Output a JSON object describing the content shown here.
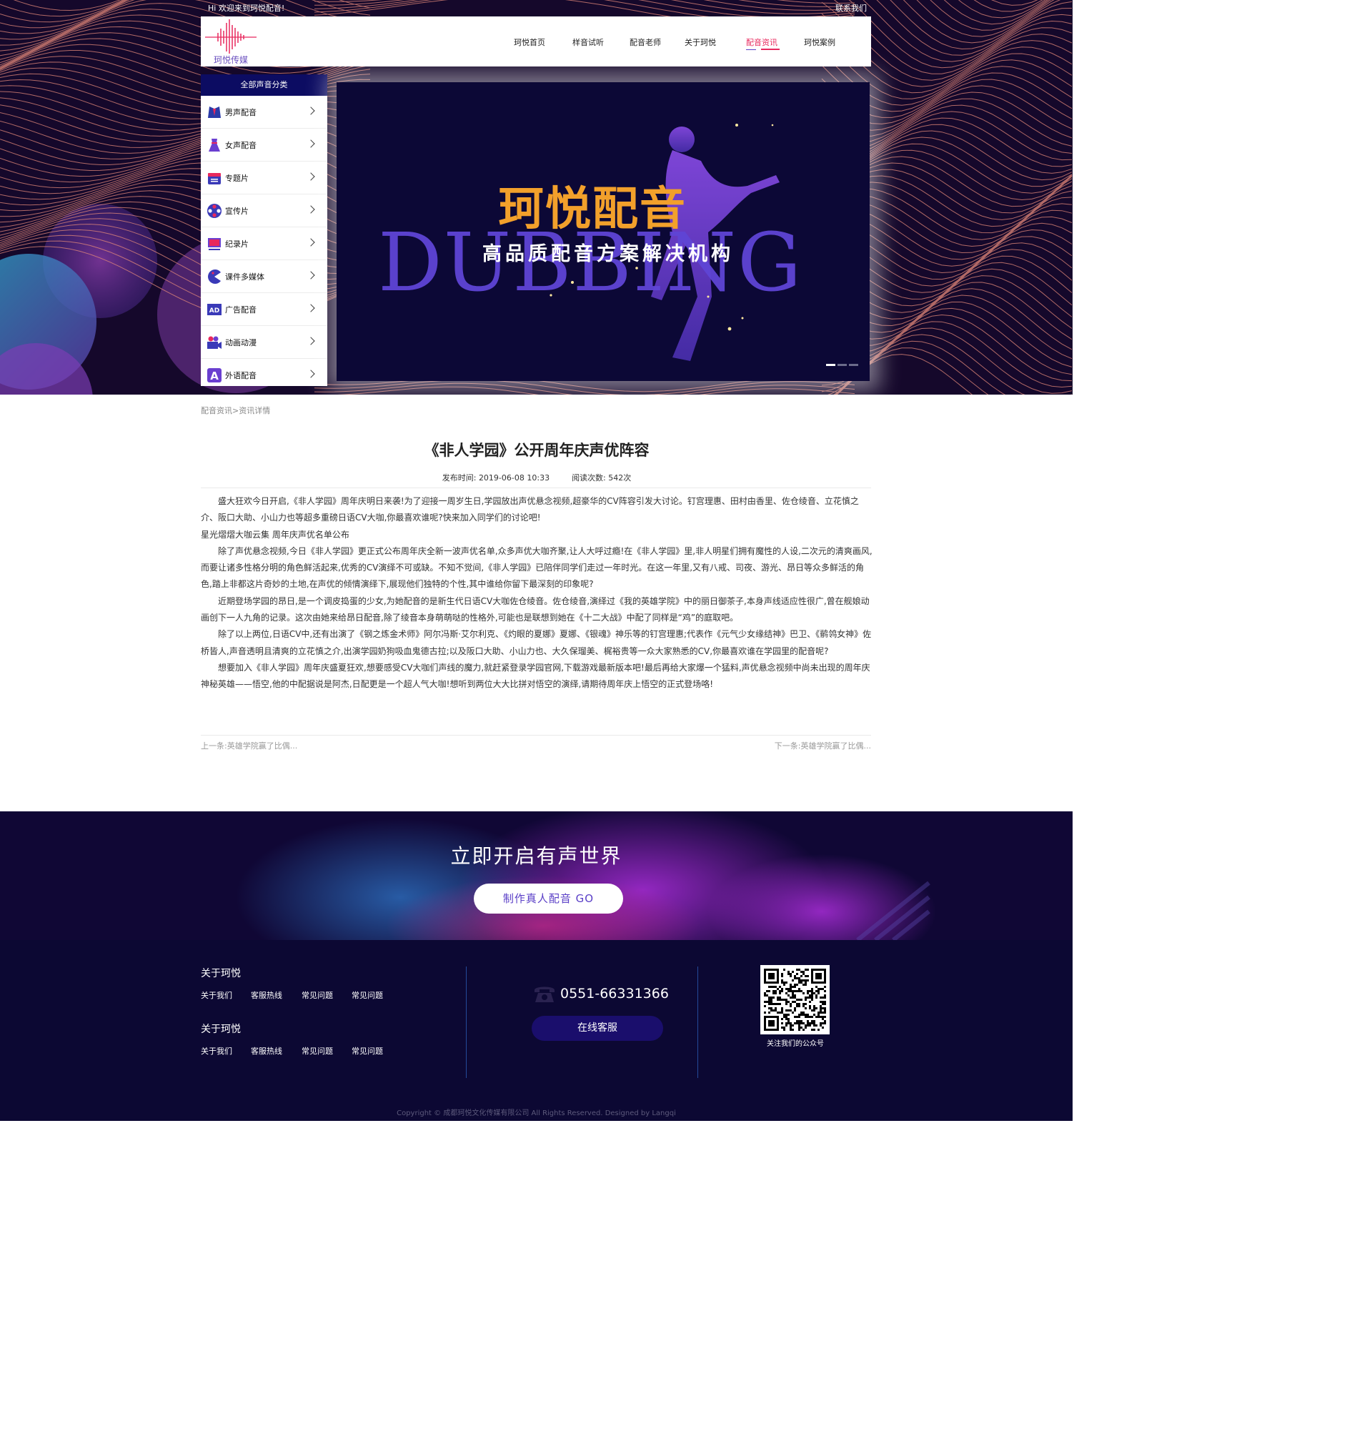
{
  "topbar": {
    "welcome": "Hi 欢迎来到珂悦配音!",
    "contact": "联系我们"
  },
  "logo": {
    "text": "珂悦传媒"
  },
  "nav": {
    "items": [
      {
        "label": "珂悦首页",
        "active": false
      },
      {
        "label": "样音试听",
        "active": false
      },
      {
        "label": "配音老师",
        "active": false
      },
      {
        "label": "关于珂悦",
        "active": false
      },
      {
        "label": "配音资讯",
        "active": true
      },
      {
        "label": "珂悦案例",
        "active": false
      }
    ],
    "active_color": "#e8285d"
  },
  "sidebar": {
    "title": "全部声音分类",
    "items": [
      {
        "label": "男声配音",
        "icon": "male-suit-icon"
      },
      {
        "label": "女声配音",
        "icon": "female-dress-icon"
      },
      {
        "label": "专题片",
        "icon": "folder-icon"
      },
      {
        "label": "宣传片",
        "icon": "film-reel-icon"
      },
      {
        "label": "纪录片",
        "icon": "monitor-icon"
      },
      {
        "label": "课件多媒体",
        "icon": "pacman-icon"
      },
      {
        "label": "广告配音",
        "icon": "ad-icon"
      },
      {
        "label": "动画动漫",
        "icon": "camera-icon"
      },
      {
        "label": "外语配音",
        "icon": "letter-a-icon"
      }
    ]
  },
  "banner": {
    "title": "珂悦配音",
    "word": "DUBBING",
    "subtitle": "高品质配音方案解决机构",
    "slide_count": 3,
    "active_slide": 1
  },
  "breadcrumb": {
    "items": [
      "配音资讯",
      "资讯详情"
    ],
    "sep": ">"
  },
  "article": {
    "title": "《非人学园》公开周年庆声优阵容",
    "publish_label": "发布时间:",
    "publish_time": "2019-06-08 10:33",
    "views_label": "阅读次数:",
    "views": "542次",
    "paragraphs": [
      "　　盛大狂欢今日开启,《非人学园》周年庆明日来袭!为了迎接一周岁生日,学园放出声优悬念视频,超豪华的CV阵容引发大讨论。钉宫理惠、田村由香里、佐仓绫音、立花慎之介、阪口大助、小山力也等超多重磅日语CV大咖,你最喜欢谁呢?快来加入同学们的讨论吧!",
      "星光熠熠大咖云集 周年庆声优名单公布",
      "　　除了声优悬念视频,今日《非人学园》更正式公布周年庆全新一波声优名单,众多声优大咖齐聚,让人大呼过瘾!在《非人学园》里,非人明星们拥有魔性的人设,二次元的清爽画风,而要让诸多性格分明的角色鲜活起来,优秀的CV演绎不可或缺。不知不觉间,《非人学园》已陪伴同学们走过一年时光。在这一年里,又有八戒、司夜、游光、昂日等众多鲜活的角色,踏上非都这片奇妙的土地,在声优的倾情演绎下,展现他们独特的个性,其中谁给你留下最深刻的印象呢?",
      "　　近期登场学园的昂日,是一个调皮捣蛋的少女,为她配音的是新生代日语CV大咖佐仓绫音。佐仓绫音,演绎过《我的英雄学院》中的丽日御茶子,本身声线适应性很广,曾在舰娘动画创下一人九角的记录。这次由她来给昂日配音,除了绫音本身萌萌哒的性格外,可能也是联想到她在《十二大战》中配了同样是“鸡”的庭取吧。",
      "　　除了以上两位,日语CV中,还有出演了《钢之炼金术师》阿尔冯斯·艾尔利克、《灼眼的夏娜》夏娜、《银魂》神乐等的钉宫理惠;代表作《元气少女缘结神》巴卫、《鹡鸰女神》佐桥皆人,声音透明且清爽的立花慎之介,出演学园奶狗吸血鬼德古拉;以及阪口大助、小山力也、大久保瑠美、梶裕贵等一众大家熟悉的CV,你最喜欢谁在学园里的配音呢?",
      "　　想要加入《非人学园》周年庆盛夏狂欢,想要感受CV大咖们声线的魔力,就赶紧登录学园官网,下载游戏最新版本吧!最后再给大家爆一个猛料,声优悬念视频中尚未出现的周年庆神秘英雄——悟空,他的中配据说是阿杰,日配更是一个超人气大咖!想听到两位大大比拼对悟空的演绎,请期待周年庆上悟空的正式登场咯!"
    ],
    "prev": "上一条:英雄学院赢了比偶...",
    "next": "下一条:英雄学院赢了比偶..."
  },
  "cta": {
    "title": "立即开启有声世界",
    "button": "制作真人配音  GO"
  },
  "footer": {
    "groups": [
      {
        "title": "关于珂悦",
        "links": [
          "关于我们",
          "客服热线",
          "常见问题",
          "常见问题"
        ]
      },
      {
        "title": "关于珂悦",
        "links": [
          "关于我们",
          "客服热线",
          "常见问题",
          "常见问题"
        ]
      }
    ],
    "phone": "0551-66331366",
    "online": "在线客服",
    "qr_caption": "关注我们的公众号",
    "copyright": "Copyright © 成都珂悦文化传媒有限公司 All Rights Reserved. Designed by Langqi"
  },
  "colors": {
    "accent": "#e8285d",
    "navy": "#0c0c62",
    "footer_bg": "#0c0833"
  }
}
